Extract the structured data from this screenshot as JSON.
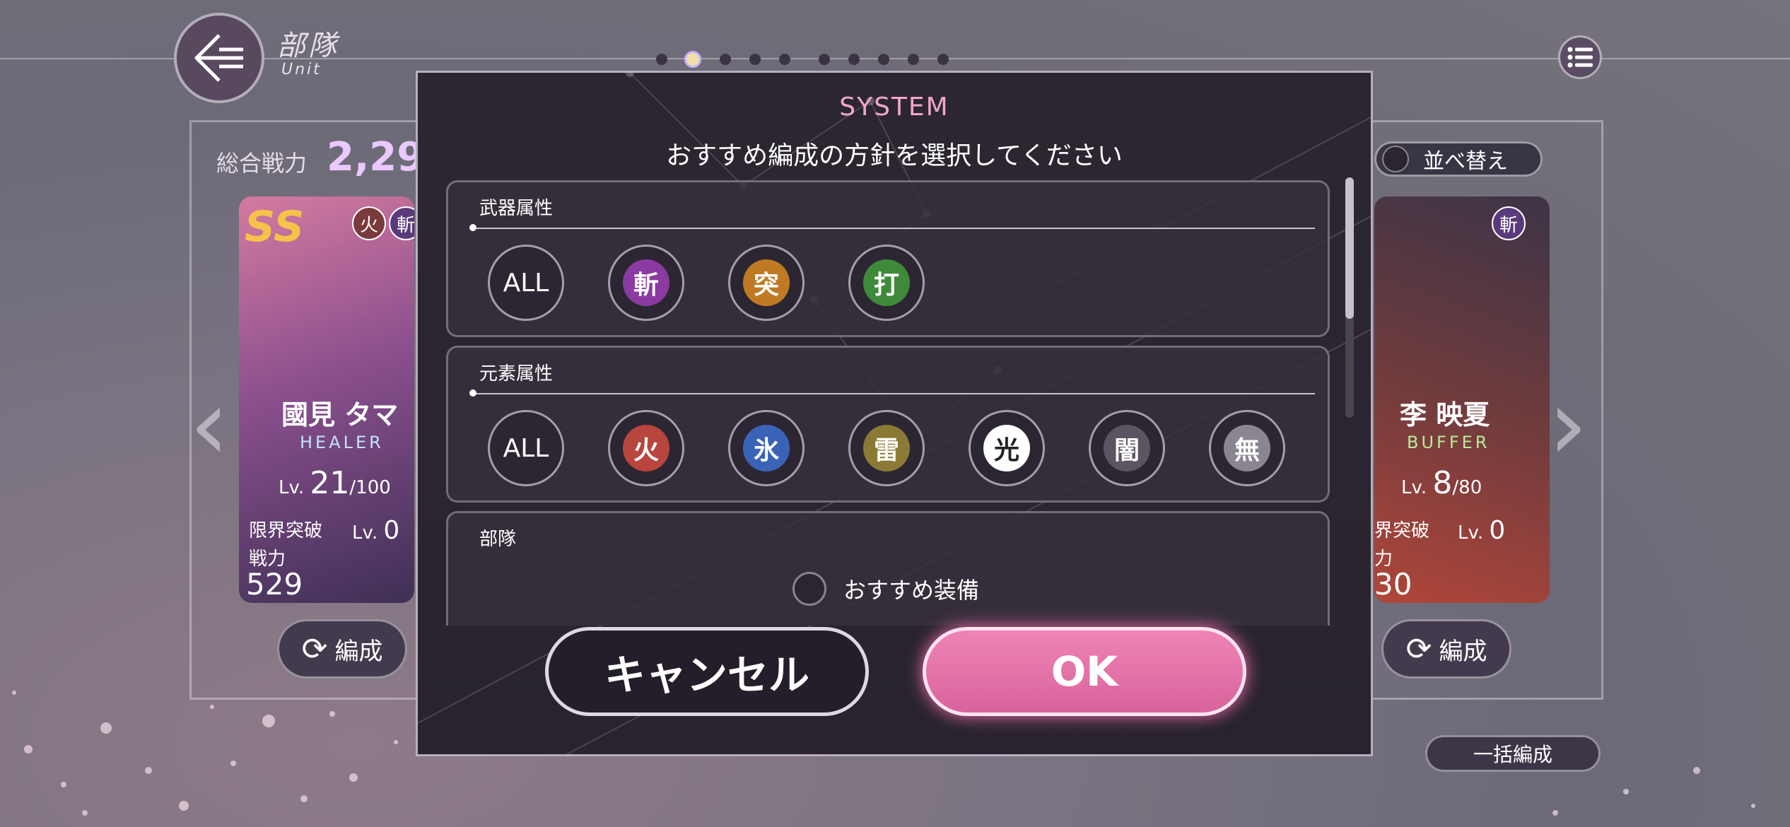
{
  "header": {
    "title": "部隊",
    "subtitle": "Unit",
    "page_dots": 10,
    "active_dot": 1
  },
  "unit": {
    "power_label": "総合戦力",
    "power_value": "2,29",
    "sort_label": "並べ替え",
    "bulk_label": "一括編成",
    "edit_label": "編成"
  },
  "cards": [
    {
      "rarity": "SS",
      "name": "國見 タマ",
      "role": "HEALER",
      "role_color": "#bfe4ff",
      "lv_prefix": "Lv.",
      "lv": "21",
      "lv_max": "/100",
      "limit_label": "限界突破",
      "limit_lv_prefix": "Lv.",
      "limit_lv": "0",
      "power_label": "戦力",
      "power": "529",
      "badges": [
        "火",
        "斬"
      ]
    },
    {
      "name": "李 映夏",
      "role": "BUFFER",
      "role_color": "#b7ec9a",
      "lv_prefix": "Lv.",
      "lv": "8",
      "lv_max": "/80",
      "limit_label": "界突破",
      "limit_lv_prefix": "Lv.",
      "limit_lv": "0",
      "power_label": "力",
      "power": "30",
      "badges": [
        "斬"
      ]
    }
  ],
  "dialog": {
    "system_label": "SYSTEM",
    "title": "おすすめ編成の方針を選択してください",
    "recommended_equipment_label": "おすすめ装備",
    "cancel_label": "キャンセル",
    "ok_label": "OK",
    "sections": [
      {
        "label": "武器属性",
        "options": [
          {
            "text": "ALL"
          },
          {
            "text": "斬",
            "color": "#8a3aa0"
          },
          {
            "text": "突",
            "color": "#c07a24"
          },
          {
            "text": "打",
            "color": "#3f8a3a"
          }
        ]
      },
      {
        "label": "元素属性",
        "options": [
          {
            "text": "ALL"
          },
          {
            "text": "火",
            "color": "#b8453e"
          },
          {
            "text": "氷",
            "color": "#3a63b8"
          },
          {
            "text": "雷",
            "color": "#8a7a35"
          },
          {
            "text": "光",
            "color": "#ffffff"
          },
          {
            "text": "闇",
            "color": "#5a5560"
          },
          {
            "text": "無",
            "color": "#8a8590"
          }
        ]
      },
      {
        "label": "部隊",
        "options": []
      }
    ]
  }
}
